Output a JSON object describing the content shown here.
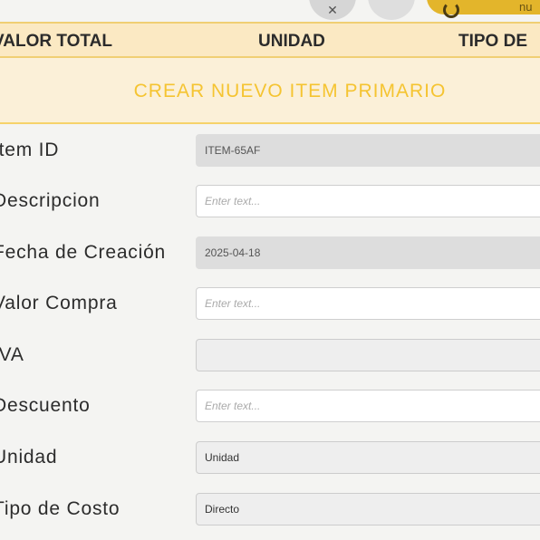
{
  "table_header": {
    "columns": [
      "VALOR TOTAL",
      "UNIDAD",
      "TIPO DE"
    ]
  },
  "top_actions": {
    "pill_text": "nu"
  },
  "colors": {
    "accent": "#f5c431",
    "header_bg": "#fbe9c3",
    "pill": "#e3b52b"
  },
  "modal": {
    "title": "CREAR NUEVO ITEM PRIMARIO",
    "fields": [
      {
        "label": "Item ID",
        "value": "ITEM-65AF",
        "placeholder": "",
        "state": "disabled"
      },
      {
        "label": "Descripcion",
        "value": "",
        "placeholder": "Enter text...",
        "state": "editable"
      },
      {
        "label": "Fecha de Creación",
        "value": "2025-04-18",
        "placeholder": "",
        "state": "disabled"
      },
      {
        "label": "Valor Compra",
        "value": "",
        "placeholder": "Enter text...",
        "state": "editable"
      },
      {
        "label": "IVA",
        "value": "",
        "placeholder": "",
        "state": "readonly"
      },
      {
        "label": "Descuento",
        "value": "",
        "placeholder": "Enter text...",
        "state": "editable"
      },
      {
        "label": "Unidad",
        "value": "Unidad",
        "placeholder": "",
        "state": "select"
      },
      {
        "label": "Tipo de Costo",
        "value": "Directo",
        "placeholder": "",
        "state": "select"
      }
    ]
  }
}
